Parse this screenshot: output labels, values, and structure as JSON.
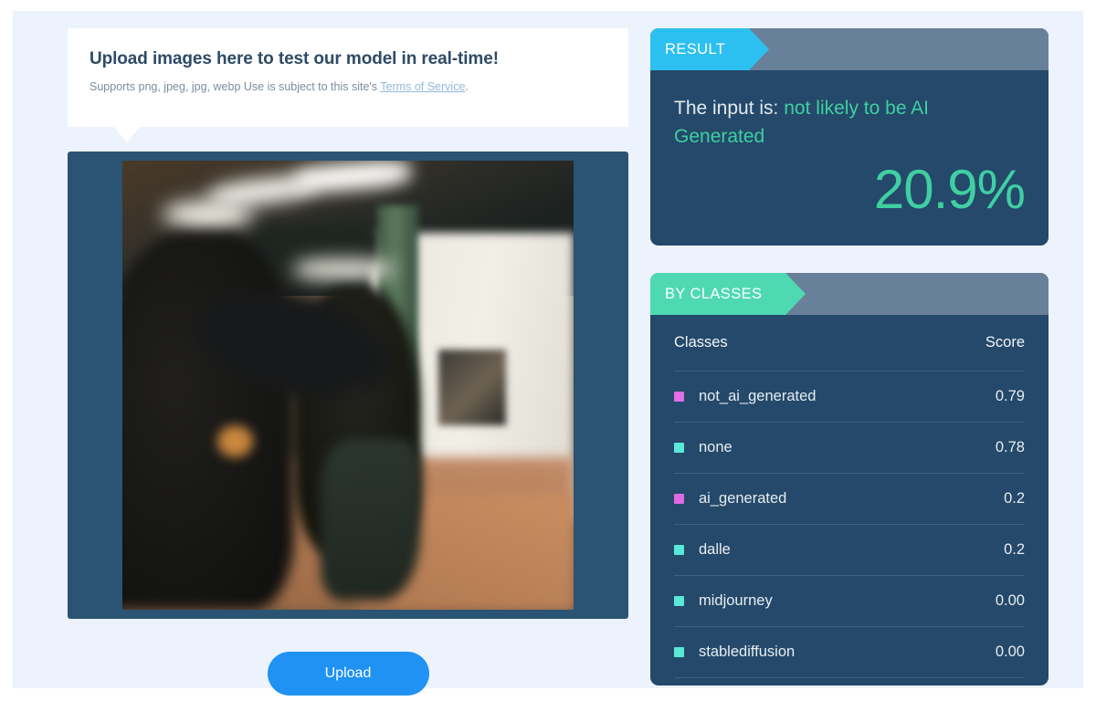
{
  "upload": {
    "title": "Upload images here to test our model in real-time!",
    "subtitle_before": "Supports png, jpeg, jpg, webp Use is subject to this site's ",
    "tos_link": "Terms of Service",
    "subtitle_after": ".",
    "button_label": "Upload"
  },
  "preview": {
    "alt": "blurred photo of two people in a subway station"
  },
  "result": {
    "tag": "RESULT",
    "prefix": "The input is:",
    "verdict": "not likely to be AI Generated",
    "percent": "20.9%",
    "accent_color": "#3fcfa2",
    "tag_color": "#2bc0f0"
  },
  "classes": {
    "tag": "BY CLASSES",
    "tag_color": "#4ed9b2",
    "col_class_header": "Classes",
    "col_score_header": "Score",
    "rows": [
      {
        "label": "not_ai_generated",
        "score": "0.79",
        "color": "#e26ee8"
      },
      {
        "label": "none",
        "score": "0.78",
        "color": "#5ae8d8"
      },
      {
        "label": "ai_generated",
        "score": "0.2",
        "color": "#e06ae6"
      },
      {
        "label": "dalle",
        "score": "0.2",
        "color": "#5ae8d8"
      },
      {
        "label": "midjourney",
        "score": "0.00",
        "color": "#5ae8d8"
      },
      {
        "label": "stablediffusion",
        "score": "0.00",
        "color": "#5ae8d8"
      }
    ]
  },
  "theme": {
    "page_bg": "#edf3fc",
    "panel_bg": "#24496a",
    "panel_header_bg": "#69809a",
    "preview_frame": "#2b5374",
    "button_bg": "#1f92f3"
  }
}
